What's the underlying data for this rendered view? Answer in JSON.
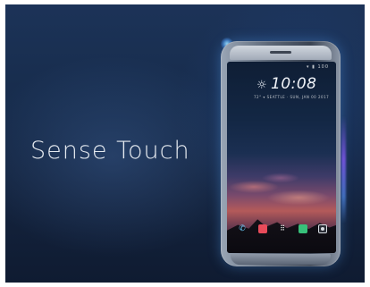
{
  "slide": {
    "headline": "Sense Touch"
  },
  "phone_screen": {
    "clock": "10:08",
    "weather_icon": "sun-icon",
    "status": "▾ ▮ 100",
    "location_line": "72° ▾ SEATTLE · SUN, JAN 00 2017"
  },
  "dock": {
    "icons": [
      "phone-icon",
      "mail-icon",
      "app-drawer-icon",
      "messages-icon",
      "camera-icon"
    ]
  },
  "colors": {
    "background": "#172c4c",
    "headline_text": "#f5f8fc",
    "edge_glow": "#8c5aff",
    "mail_icon": "#e84b5a",
    "messages_icon": "#37c07a",
    "phone_icon": "#6ad0ff"
  }
}
